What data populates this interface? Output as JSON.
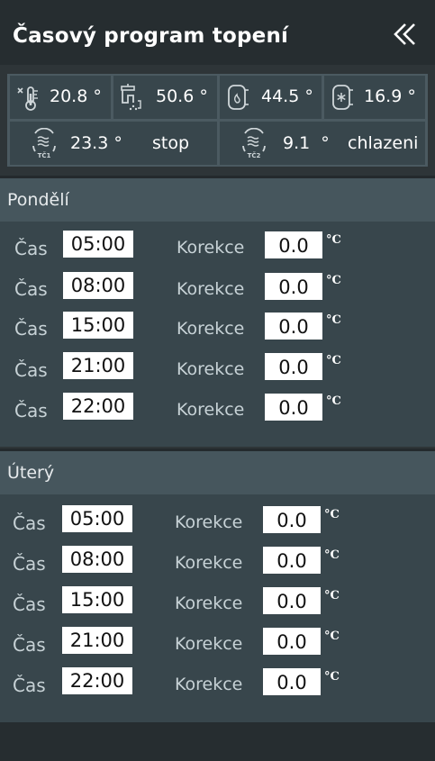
{
  "header": {
    "title": "Časový program topení",
    "back_icon": "double-chevron-left-icon"
  },
  "status": {
    "sensors": [
      {
        "name": "outdoor-temp",
        "icon": "thermometer-icon",
        "value": "20.8 °"
      },
      {
        "name": "hot-water-temp",
        "icon": "tap-icon",
        "value": "50.6 °"
      },
      {
        "name": "boiler-temp",
        "icon": "heating-tank-icon",
        "value": "44.5 °"
      },
      {
        "name": "cooling-temp",
        "icon": "cooling-tank-icon",
        "value": "16.9 °"
      }
    ],
    "heat_pumps": [
      {
        "icon": "heat-pump-1-icon",
        "badge": "TČ1",
        "value": "23.3 °",
        "state": "stop"
      },
      {
        "icon": "heat-pump-2-icon",
        "badge": "TČ2",
        "value": "9.1  °",
        "state": "chlazeni"
      }
    ]
  },
  "days": [
    {
      "name": "Pondělí",
      "time_label": "Čas",
      "correction_label": "Korekce",
      "unit": "°C",
      "rows": [
        {
          "time": "05:00",
          "correction": "0.0"
        },
        {
          "time": "08:00",
          "correction": "0.0"
        },
        {
          "time": "15:00",
          "correction": "0.0"
        },
        {
          "time": "21:00",
          "correction": "0.0"
        },
        {
          "time": "22:00",
          "correction": "0.0"
        }
      ]
    },
    {
      "name": "Úterý",
      "time_label": "Čas",
      "correction_label": "Korekce",
      "unit": "°C",
      "rows": [
        {
          "time": "05:00",
          "correction": "0.0"
        },
        {
          "time": "08:00",
          "correction": "0.0"
        },
        {
          "time": "15:00",
          "correction": "0.0"
        },
        {
          "time": "21:00",
          "correction": "0.0"
        },
        {
          "time": "22:00",
          "correction": "0.0"
        }
      ]
    }
  ]
}
